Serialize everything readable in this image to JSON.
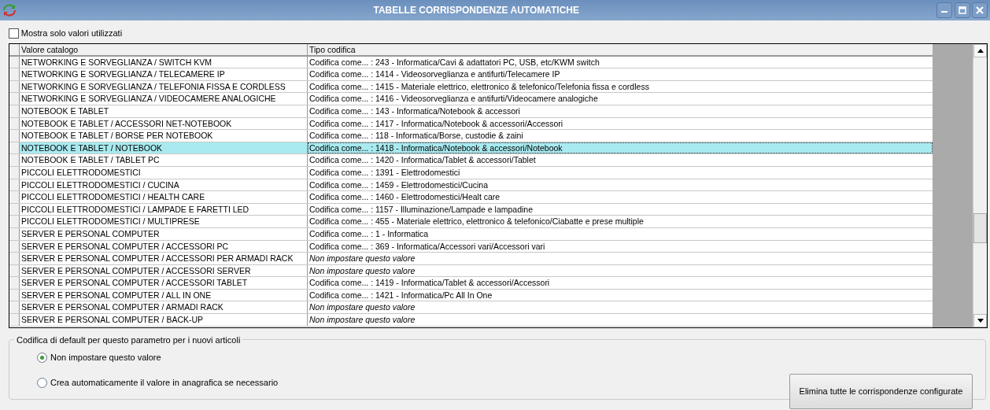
{
  "window": {
    "title": "TABELLE CORRISPONDENZE AUTOMATICHE"
  },
  "filter": {
    "label": "Mostra solo valori utilizzati",
    "checked": false
  },
  "table": {
    "columns": [
      "Valore catalogo",
      "Tipo codifica"
    ],
    "rows": [
      {
        "value": "NETWORKING E SORVEGLIANZA / SWITCH KVM",
        "kind": "coded",
        "code": "Codifica come... : 243 - Informatica/Cavi & adattatori PC, USB, etc/KWM switch",
        "selected": false
      },
      {
        "value": "NETWORKING E SORVEGLIANZA / TELECAMERE IP",
        "kind": "coded",
        "code": "Codifica come... : 1414 - Videosorveglianza e antifurti/Telecamere IP",
        "selected": false
      },
      {
        "value": "NETWORKING E SORVEGLIANZA / TELEFONIA FISSA E CORDLESS",
        "kind": "coded",
        "code": "Codifica come... : 1415 - Materiale elettrico, elettronico & telefonico/Telefonia fissa e cordless",
        "selected": false
      },
      {
        "value": "NETWORKING E SORVEGLIANZA / VIDEOCAMERE ANALOGICHE",
        "kind": "coded",
        "code": "Codifica come... : 1416 - Videosorveglianza e antifurti/Videocamere analogiche",
        "selected": false
      },
      {
        "value": "NOTEBOOK E TABLET",
        "kind": "coded",
        "code": "Codifica come... : 143 - Informatica/Notebook & accessori",
        "selected": false
      },
      {
        "value": "NOTEBOOK E TABLET / ACCESSORI NET-NOTEBOOK",
        "kind": "coded",
        "code": "Codifica come... : 1417 - Informatica/Notebook & accessori/Accessori",
        "selected": false
      },
      {
        "value": "NOTEBOOK E TABLET / BORSE PER NOTEBOOK",
        "kind": "coded",
        "code": "Codifica come... : 118 - Informatica/Borse, custodie & zaini",
        "selected": false
      },
      {
        "value": "NOTEBOOK E TABLET / NOTEBOOK",
        "kind": "coded",
        "code": "Codifica come... : 1418 - Informatica/Notebook & accessori/Notebook",
        "selected": true
      },
      {
        "value": "NOTEBOOK E TABLET / TABLET PC",
        "kind": "coded",
        "code": "Codifica come... : 1420 - Informatica/Tablet & accessori/Tablet",
        "selected": false
      },
      {
        "value": "PICCOLI ELETTRODOMESTICI",
        "kind": "coded",
        "code": "Codifica come... : 1391 - Elettrodomestici",
        "selected": false
      },
      {
        "value": "PICCOLI ELETTRODOMESTICI / CUCINA",
        "kind": "coded",
        "code": "Codifica come... : 1459 - Elettrodomestici/Cucina",
        "selected": false
      },
      {
        "value": "PICCOLI ELETTRODOMESTICI / HEALTH CARE",
        "kind": "coded",
        "code": "Codifica come... : 1460 - Elettrodomestici/Healt care",
        "selected": false
      },
      {
        "value": "PICCOLI ELETTRODOMESTICI / LAMPADE E FARETTI LED",
        "kind": "coded",
        "code": "Codifica come... : 1157 - Illuminazione/Lampade e lampadine",
        "selected": false
      },
      {
        "value": "PICCOLI ELETTRODOMESTICI / MULTIPRESE",
        "kind": "coded",
        "code": "Codifica come... : 455 - Materiale elettrico, elettronico & telefonico/Ciabatte e prese multiple",
        "selected": false
      },
      {
        "value": "SERVER E PERSONAL COMPUTER",
        "kind": "coded",
        "code": "Codifica come... : 1 - Informatica",
        "selected": false
      },
      {
        "value": "SERVER E PERSONAL COMPUTER / ACCESSORI PC",
        "kind": "coded",
        "code": "Codifica come... : 369 - Informatica/Accessori vari/Accessori vari",
        "selected": false
      },
      {
        "value": "SERVER E PERSONAL COMPUTER / ACCESSORI PER ARMADI RACK",
        "kind": "unset",
        "code": "Non impostare questo valore",
        "selected": false
      },
      {
        "value": "SERVER E PERSONAL COMPUTER / ACCESSORI SERVER",
        "kind": "unset",
        "code": "Non impostare questo valore",
        "selected": false
      },
      {
        "value": "SERVER E PERSONAL COMPUTER / ACCESSORI TABLET",
        "kind": "coded",
        "code": "Codifica come... : 1419 - Informatica/Tablet & accessori/Accessori",
        "selected": false
      },
      {
        "value": "SERVER E PERSONAL COMPUTER / ALL IN ONE",
        "kind": "coded",
        "code": "Codifica come... : 1421 - Informatica/Pc All In One",
        "selected": false
      },
      {
        "value": "SERVER E PERSONAL COMPUTER / ARMADI RACK",
        "kind": "unset",
        "code": "Non impostare questo valore",
        "selected": false
      },
      {
        "value": "SERVER E PERSONAL COMPUTER / BACK-UP",
        "kind": "unset",
        "code": "Non impostare questo valore",
        "selected": false
      }
    ]
  },
  "default_group": {
    "title": "Codifica di default per questo parametro per i nuovi articoli",
    "options": [
      {
        "label": "Non impostare questo valore",
        "selected": true
      },
      {
        "label": "Crea automaticamente il valore in anagrafica se necessario",
        "selected": false
      }
    ]
  },
  "buttons": [
    "Elimina tutte le corrispondenze configurate"
  ]
}
